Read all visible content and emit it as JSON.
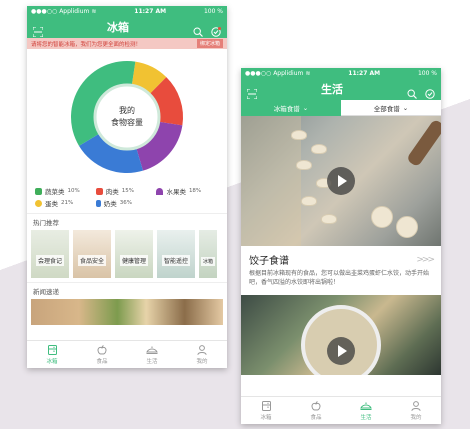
{
  "colors": {
    "brand": "#3fbd7f",
    "alert_bg": "#f4c8c3",
    "alert_text": "#d0413a",
    "tab_active": "#3fbd7f",
    "tab_inactive": "#999999"
  },
  "status_bar": {
    "carrier": "Applidium",
    "time": "11:27 AM",
    "battery": "100 %"
  },
  "phone1": {
    "title": "冰箱",
    "alert_text": "请将您的智能冰箱，我们为您更全面的检测！",
    "alert_button": "绑定冰箱",
    "donut_center_line1": "我的",
    "donut_center_line2": "食物容量",
    "donut_segments": [
      {
        "name": "蔬菜类",
        "percent": 10,
        "color": "#f1c232"
      },
      {
        "name": "肉类",
        "percent": 15,
        "color": "#e84c3d"
      },
      {
        "name": "水果类",
        "percent": 18,
        "color": "#8e44ad"
      },
      {
        "name": "蛋类",
        "percent": 21,
        "color": "#3a7bd5"
      },
      {
        "name": "奶类",
        "percent": 36,
        "color": "#3fbd7f"
      }
    ],
    "legend": [
      {
        "label": "蔬菜类",
        "value": "10%",
        "icon": "vegetable-icon",
        "color": "#3fae5a"
      },
      {
        "label": "肉类",
        "value": "15%",
        "icon": "meat-icon",
        "color": "#e84c3d"
      },
      {
        "label": "水果类",
        "value": "18%",
        "icon": "fruit-icon",
        "color": "#8e44ad"
      },
      {
        "label": "蛋类",
        "value": "21%",
        "icon": "egg-icon",
        "color": "#f1c232"
      },
      {
        "label": "奶类",
        "value": "36%",
        "icon": "milk-icon",
        "color": "#3a7bd5"
      }
    ],
    "hot_title": "热门推荐",
    "hot_items": [
      "会理食记",
      "食品安全",
      "健康管理",
      "智能遥控",
      "冰箱"
    ],
    "news_title": "新闻速递",
    "tabs": [
      {
        "label": "冰箱",
        "icon": "fridge-icon",
        "active": true
      },
      {
        "label": "食品",
        "icon": "apple-icon",
        "active": false
      },
      {
        "label": "生活",
        "icon": "life-icon",
        "active": false
      },
      {
        "label": "我的",
        "icon": "person-icon",
        "active": false
      }
    ]
  },
  "phone2": {
    "title": "生活",
    "segments": [
      {
        "label": "冰箱食谱",
        "active": true
      },
      {
        "label": "全部食谱",
        "active": false
      }
    ],
    "article_title": "饺子食谱",
    "article_desc": "根据目前冰箱现有的食品，您可以做出韭菜鸡蛋虾仁水饺，动手开始吧，香气四溢的水饺即将出锅啦！",
    "tabs": [
      {
        "label": "冰箱",
        "icon": "fridge-icon",
        "active": false
      },
      {
        "label": "食品",
        "icon": "apple-icon",
        "active": false
      },
      {
        "label": "生活",
        "icon": "life-icon",
        "active": true
      },
      {
        "label": "我的",
        "icon": "person-icon",
        "active": false
      }
    ]
  }
}
